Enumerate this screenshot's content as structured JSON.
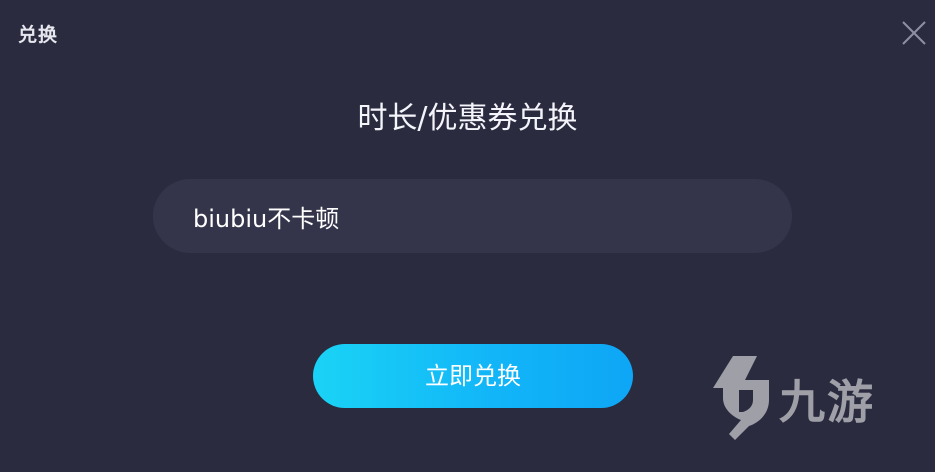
{
  "window": {
    "title": "兑换",
    "close_icon": "close-icon"
  },
  "heading": "时长/优惠券兑换",
  "code_input": {
    "value": "biubiu不卡顿",
    "placeholder": ""
  },
  "redeem_button": {
    "label": "立即兑换"
  },
  "watermark": {
    "logo_icon": "nine-game-logo-icon",
    "text": "九游"
  },
  "colors": {
    "background": "#2a2b3f",
    "input_background": "#34354b",
    "button_gradient_start": "#1ad3f5",
    "button_gradient_end": "#0ea6f6"
  }
}
